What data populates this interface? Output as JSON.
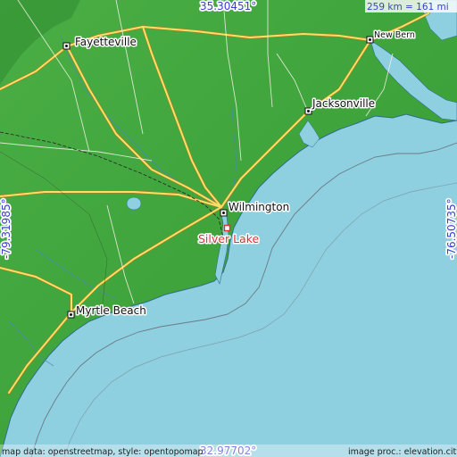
{
  "coords": {
    "top_lat": "35.30451°",
    "bottom_lat": "32.97702°",
    "left_lon": "-79.31985°",
    "right_lon": "-76.50735°"
  },
  "scale_label": "259 km = 161 mi",
  "cities": {
    "fayetteville": "Fayetteville",
    "new_bern": "New Bern",
    "jacksonville": "Jacksonville",
    "wilmington": "Wilmington",
    "myrtle_beach": "Myrtle Beach"
  },
  "target": "Silver Lake",
  "credits": {
    "left": "map data: openstreetmap, style: opentopomap",
    "right": "image proc.: elevation.city"
  },
  "colors": {
    "ocean": "#8ecfe0",
    "land": "#3fa53c",
    "marker": "#e03030",
    "label_blue": "#3a3fd0"
  }
}
